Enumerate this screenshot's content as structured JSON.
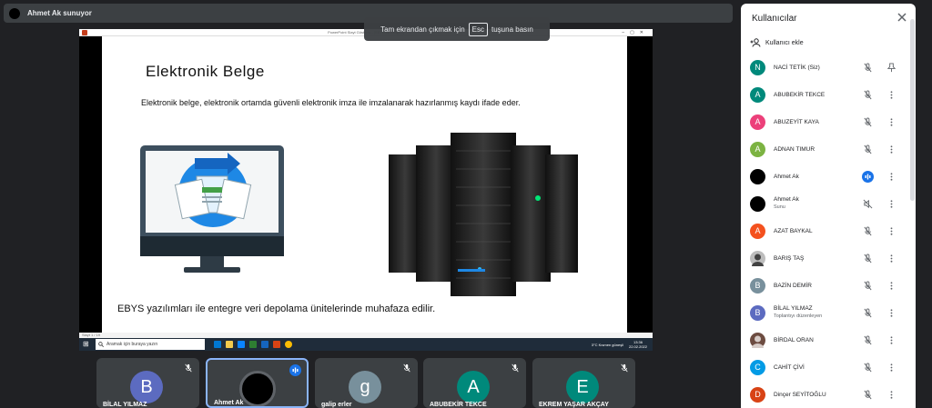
{
  "presenter_bar": {
    "text": "Ahmet Ak sunuyor"
  },
  "esc_toast": {
    "before": "Tam ekrandan çıkmak için",
    "key": "Esc",
    "after": "tuşuna basın"
  },
  "shared_screen": {
    "window_title": "PowerPoint Slayt Gösterisi - [EBYS ve Belge...]",
    "slide_title": "Elektronik Belge",
    "slide_subtitle": "Elektronik belge, elektronik ortamda güvenli elektronik imza ile imzalanarak hazırlanmış kaydı ifade eder.",
    "slide_footer": "EBYS yazılımları ile entegre veri depolama ünitelerinde muhafaza edilir.",
    "status_text": "Slayt 1 / 19",
    "taskbar": {
      "search_placeholder": "Aramak için buraya yazın",
      "weather": "3°C Kısmen güneşli",
      "time": "13:36",
      "date": "22.02.2022"
    }
  },
  "tiles": [
    {
      "name": "BİLAL YILMAZ",
      "initial": "B",
      "color": "#5c6bc0"
    },
    {
      "name": "Ahmet Ak",
      "initial": "",
      "color": "#000000"
    },
    {
      "name": "galip erler",
      "initial": "g",
      "color": "#78909c"
    },
    {
      "name": "ABUBEKİR TEKCE",
      "initial": "A",
      "color": "#00897b"
    },
    {
      "name": "EKREM YAŞAR AKÇAY",
      "initial": "E",
      "color": "#00897b"
    }
  ],
  "panel": {
    "title": "Kullanıcılar",
    "add_user_label": "Kullanıcı ekle",
    "participants": [
      {
        "name": "NACİ TETİK (Siz)",
        "initial": "N",
        "color": "#00897b"
      },
      {
        "name": "ABUBEKİR TEKCE",
        "initial": "A",
        "color": "#00897b"
      },
      {
        "name": "ABUZEYİT KAYA",
        "initial": "A",
        "color": "#ec407a"
      },
      {
        "name": "ADNAN TIMUR",
        "initial": "A",
        "color": "#7cb342"
      },
      {
        "name": "Ahmet Ak",
        "initial": "",
        "color": "#000000"
      },
      {
        "name": "Ahmet Ak",
        "sub": "Sunu",
        "initial": "",
        "color": "#000000"
      },
      {
        "name": "AZAT BAYKAL",
        "initial": "A",
        "color": "#f4511e"
      },
      {
        "name": "BARIŞ TAŞ",
        "initial": "",
        "color": "#9e9e9e"
      },
      {
        "name": "BAZİN DEMİR",
        "initial": "B",
        "color": "#78909c"
      },
      {
        "name": "BİLAL YILMAZ",
        "sub": "Toplantıyı düzenleyen",
        "initial": "B",
        "color": "#5c6bc0"
      },
      {
        "name": "BİRDAL ORAN",
        "initial": "",
        "color": "#6d4c41"
      },
      {
        "name": "CAHİT ÇİVİ",
        "initial": "C",
        "color": "#039be5"
      },
      {
        "name": "Dinçer SEYİTOĞLU",
        "initial": "D",
        "color": "#d84315"
      }
    ]
  }
}
